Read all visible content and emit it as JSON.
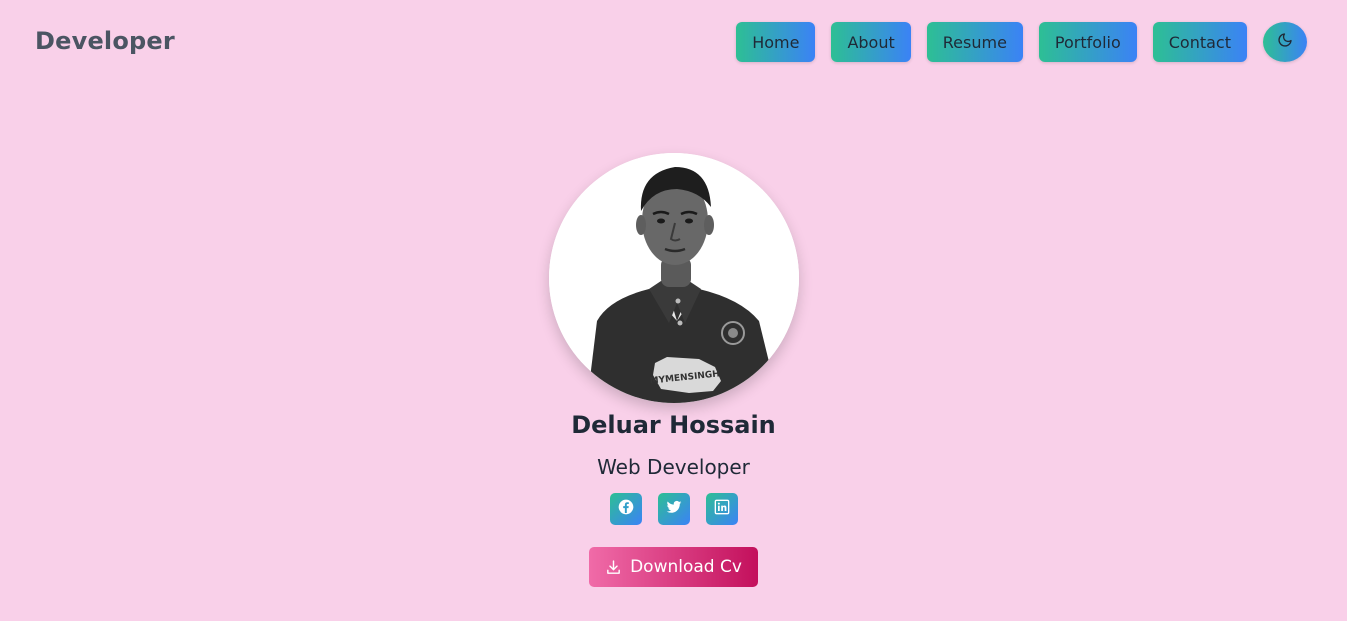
{
  "brand": {
    "logo_text": "Developer"
  },
  "nav": {
    "items": [
      {
        "label": "Home"
      },
      {
        "label": "About"
      },
      {
        "label": "Resume"
      },
      {
        "label": "Portfolio"
      },
      {
        "label": "Contact"
      }
    ],
    "theme_toggle_icon": "moon-icon"
  },
  "profile": {
    "name": "Deluar Hossain",
    "role": "Web Developer",
    "shirt_text": "MYMENSINGH",
    "socials": [
      {
        "icon": "facebook-icon"
      },
      {
        "icon": "twitter-icon"
      },
      {
        "icon": "linkedin-icon"
      }
    ],
    "download_label": "Download Cv",
    "download_icon": "download-icon"
  },
  "colors": {
    "background": "#f9d0e9",
    "nav_gradient_start": "#2dbf94",
    "nav_gradient_end": "#3b82f6",
    "download_gradient_start": "#f06ba8",
    "download_gradient_end": "#c3105c"
  }
}
